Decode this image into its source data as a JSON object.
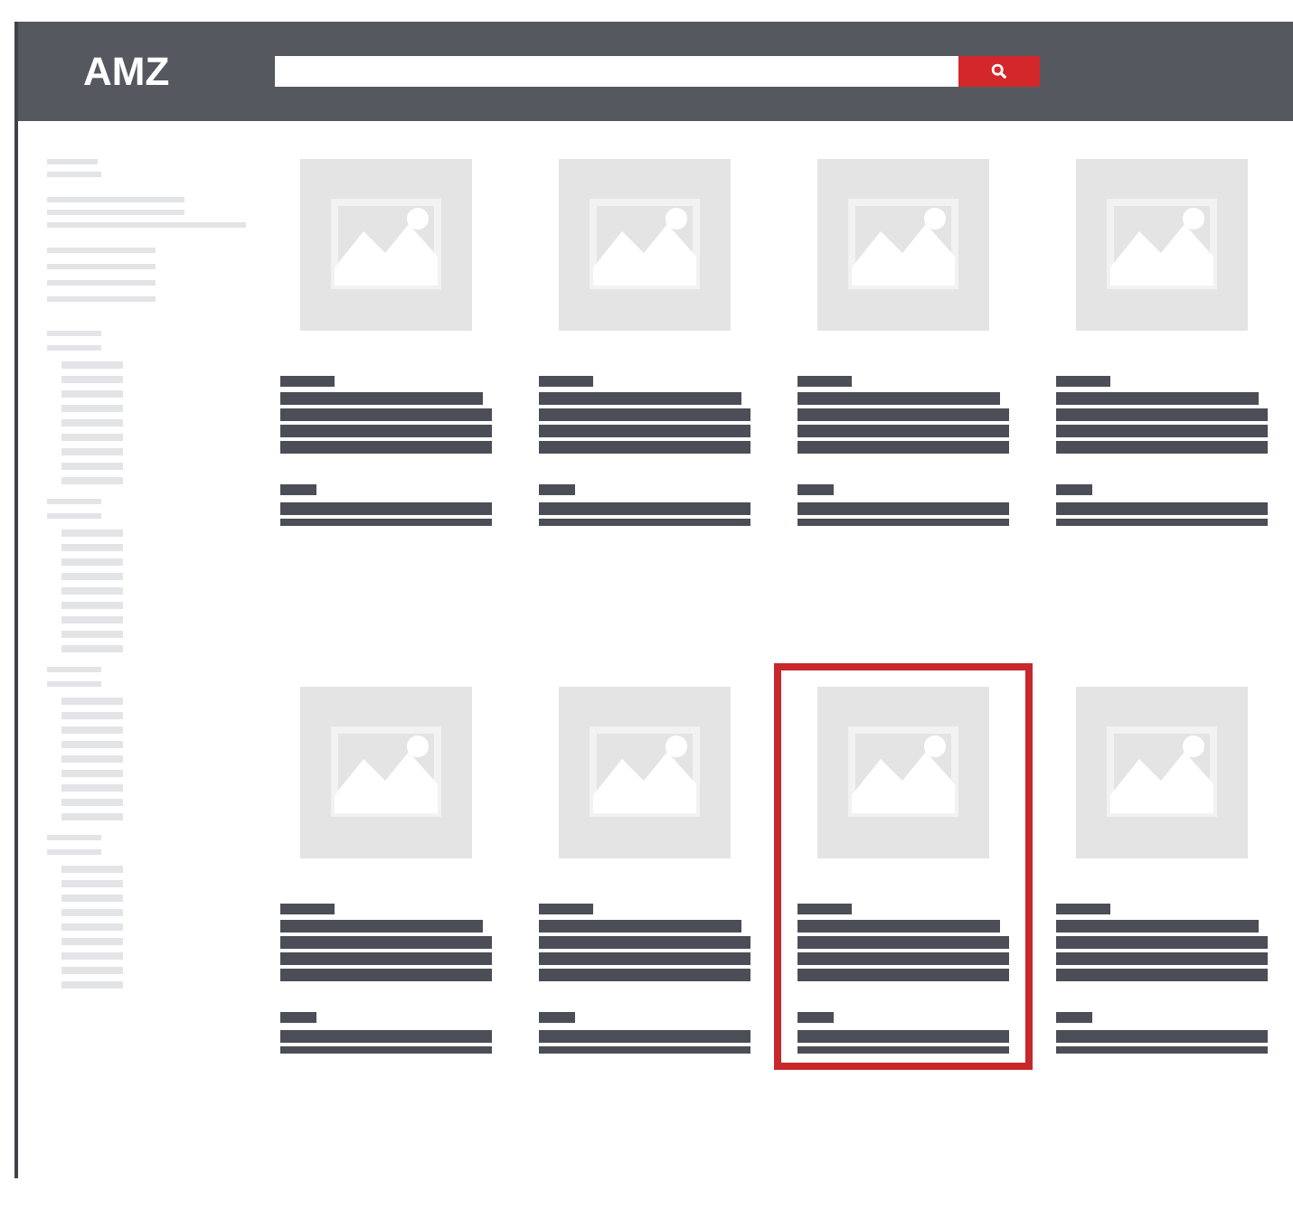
{
  "header": {
    "logo": "AMZ"
  },
  "products": [
    {
      "selected": false
    },
    {
      "selected": false
    },
    {
      "selected": false
    },
    {
      "selected": false
    },
    {
      "selected": false
    },
    {
      "selected": false
    },
    {
      "selected": true
    },
    {
      "selected": false
    }
  ]
}
